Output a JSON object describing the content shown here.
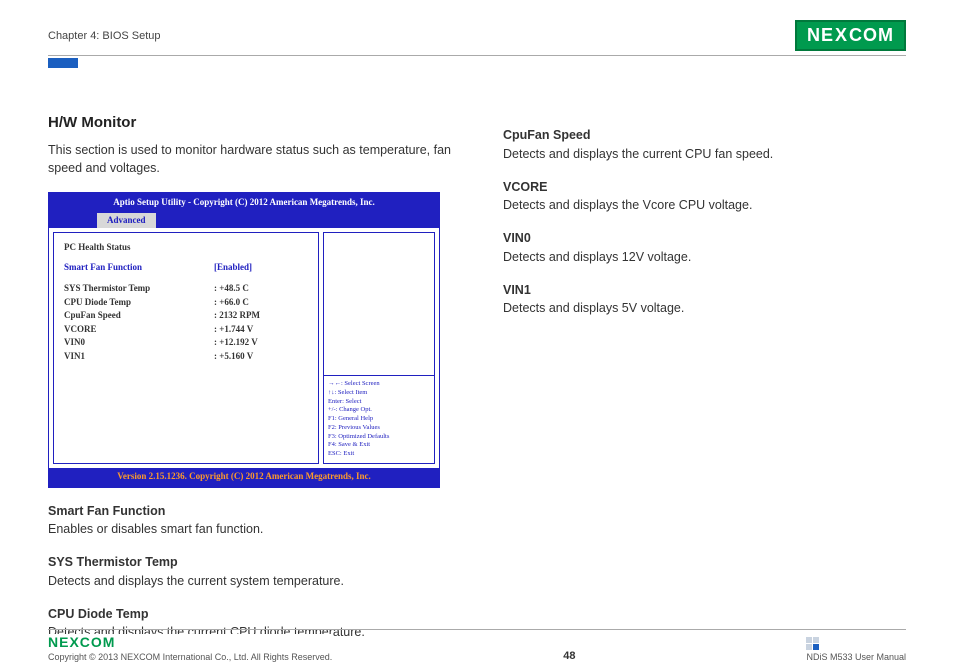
{
  "header": {
    "chapter": "Chapter 4: BIOS Setup",
    "logo": "NEXCOM"
  },
  "main": {
    "title": "H/W Monitor",
    "intro": "This section is used to monitor hardware status such as temperature, fan speed and voltages."
  },
  "bios": {
    "top": "Aptio Setup Utility - Copyright (C) 2012 American Megatrends, Inc.",
    "tab": "Advanced",
    "health_title": "PC Health Status",
    "smart_label": "Smart Fan Function",
    "smart_value": "[Enabled]",
    "rows": [
      {
        "k": "SYS Thermistor Temp",
        "v": ": +48.5 C"
      },
      {
        "k": "CPU Diode Temp",
        "v": ": +66.0 C"
      },
      {
        "k": "CpuFan Speed",
        "v": ": 2132 RPM"
      },
      {
        "k": "VCORE",
        "v": ": +1.744 V"
      },
      {
        "k": "VIN0",
        "v": ": +12.192 V"
      },
      {
        "k": "VIN1",
        "v": ": +5.160 V"
      }
    ],
    "help": [
      "→←: Select Screen",
      "↑↓: Select Item",
      "Enter: Select",
      "+/-: Change Opt.",
      "F1: General Help",
      "F2: Previous Values",
      "F3: Optimized Defaults",
      "F4: Save & Exit",
      "ESC: Exit"
    ],
    "bottom": "Version 2.15.1236. Copyright (C) 2012 American Megatrends, Inc."
  },
  "left_sections": [
    {
      "t": "Smart Fan Function",
      "b": "Enables or disables smart fan function."
    },
    {
      "t": "SYS Thermistor Temp",
      "b": "Detects and displays the current system temperature."
    },
    {
      "t": "CPU Diode Temp",
      "b": "Detects and displays the current CPU diode temperature."
    }
  ],
  "right_sections": [
    {
      "t": "CpuFan Speed",
      "b": "Detects and displays the current CPU fan speed."
    },
    {
      "t": "VCORE",
      "b": "Detects and displays the Vcore CPU voltage."
    },
    {
      "t": "VIN0",
      "b": "Detects and displays 12V voltage."
    },
    {
      "t": "VIN1",
      "b": "Detects and displays 5V voltage."
    }
  ],
  "footer": {
    "logo": "NEXCOM",
    "copyright": "Copyright © 2013 NEXCOM International Co., Ltd. All Rights Reserved.",
    "page": "48",
    "manual": "NDiS M533 User Manual"
  }
}
